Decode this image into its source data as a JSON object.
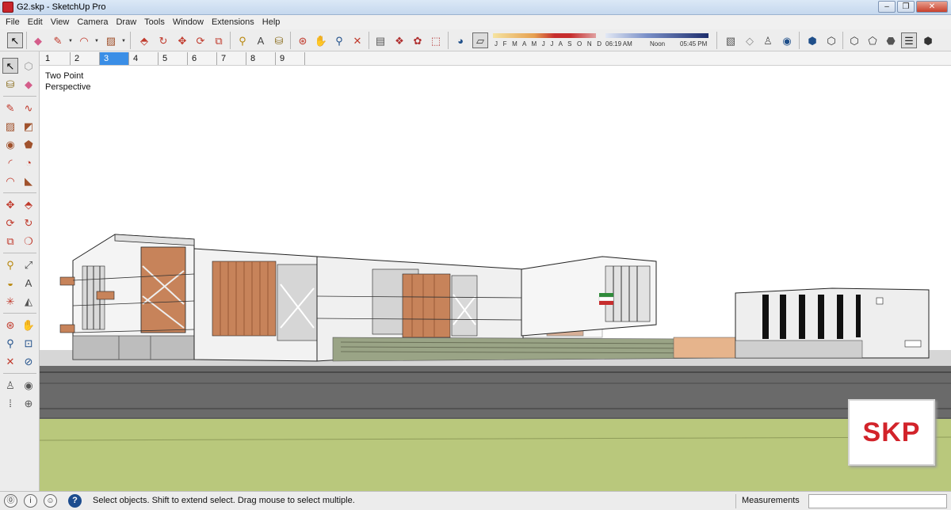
{
  "window": {
    "title": "G2.skp - SketchUp Pro",
    "minimize": "–",
    "maximize": "❐",
    "close": "✕"
  },
  "menu": [
    "File",
    "Edit",
    "View",
    "Camera",
    "Draw",
    "Tools",
    "Window",
    "Extensions",
    "Help"
  ],
  "shadows": {
    "months": "J F M A M J J A S O N D",
    "time_start": "06:19 AM",
    "time_mid": "Noon",
    "time_end": "05:45 PM"
  },
  "scenes": {
    "tabs": [
      "1",
      "2",
      "3",
      "4",
      "5",
      "6",
      "7",
      "8",
      "9"
    ],
    "selected": "3"
  },
  "viewport": {
    "camera_label": "Two Point Perspective",
    "watermark": "SKP"
  },
  "status": {
    "message": "Select objects. Shift to extend select. Drag mouse to select multiple.",
    "measurements_label": "Measurements",
    "measurements_value": "",
    "help_glyph": "?",
    "info_glyph": "i"
  },
  "colors": {
    "accent_tab": "#3a8ee6",
    "brick": "#c7835a",
    "grass": "#b9c87c",
    "road": "#6c6c6c",
    "logo_red": "#d2232a"
  },
  "icons": {
    "top": [
      "select-arrow-icon",
      "eraser-icon",
      "pencil-line-icon",
      "arc-icon",
      "rectangle-icon",
      "push-pull-icon",
      "follow-me-icon",
      "move-icon",
      "rotate-icon",
      "scale-icon",
      "tape-measure-icon",
      "text-icon",
      "paint-bucket-icon",
      "orbit-icon",
      "pan-icon",
      "zoom-icon",
      "zoom-extents-icon",
      "scenes-icon",
      "components-icon",
      "materials-icon",
      "shadows-toggle-icon",
      "fog-icon",
      "warehouse-icon",
      "sandbox-icon",
      "person-icon",
      "geo-globe-icon",
      "iso-view-icon",
      "top-view-icon",
      "front-view-icon",
      "right-view-icon",
      "back-view-icon",
      "left-view-icon"
    ],
    "left": [
      "select-icon",
      "make-component-icon",
      "paint-icon",
      "eraser-icon",
      "line-icon",
      "freehand-icon",
      "rectangle-icon",
      "rotated-rect-icon",
      "circle-icon",
      "polygon-icon",
      "arc-icon",
      "pie-icon",
      "three-point-arc-icon",
      "two-point-arc-icon",
      "move-icon",
      "push-pull-icon",
      "rotate-icon",
      "follow-me-icon",
      "scale-icon",
      "offset-icon",
      "tape-icon",
      "dimension-icon",
      "protractor-icon",
      "text-3d-icon",
      "axes-icon",
      "section-plane-icon",
      "orbit-icon",
      "pan-icon",
      "zoom-icon",
      "zoom-window-icon",
      "zoom-extents-icon",
      "previous-view-icon",
      "position-camera-icon",
      "look-around-icon",
      "walk-icon",
      "section-icon"
    ]
  }
}
